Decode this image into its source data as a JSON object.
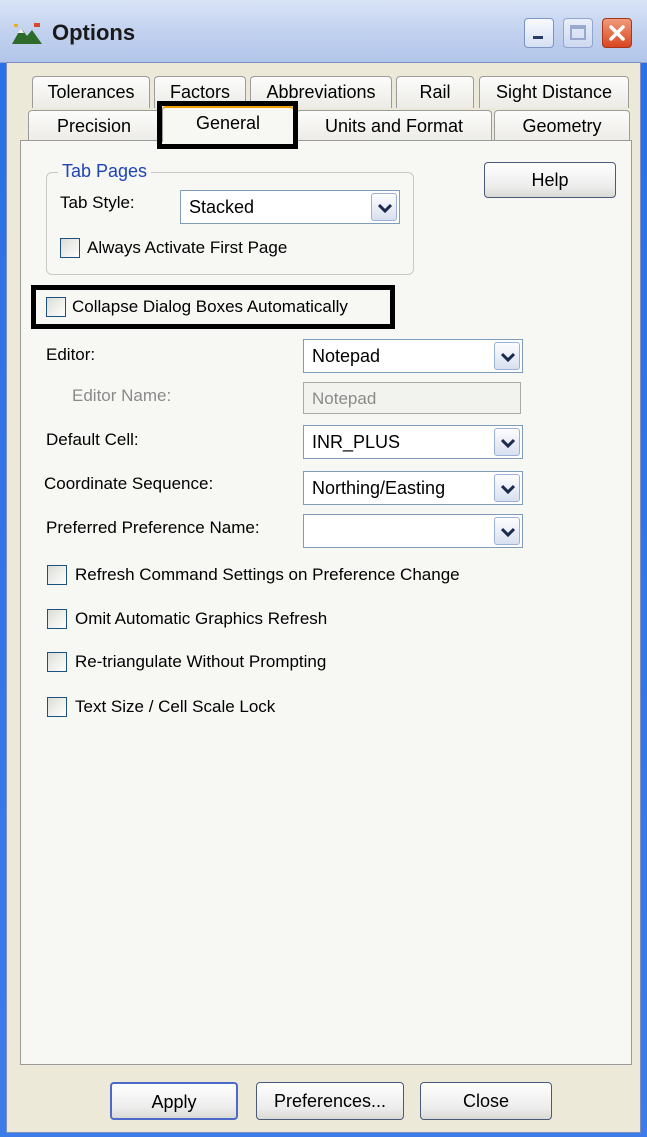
{
  "window": {
    "title": "Options"
  },
  "tabs": {
    "row_top": [
      "Tolerances",
      "Factors",
      "Abbreviations",
      "Rail",
      "Sight Distance"
    ],
    "row_bottom": [
      "Precision",
      "General",
      "Units and Format",
      "Geometry"
    ],
    "active": "General"
  },
  "tab_pages": {
    "legend": "Tab Pages",
    "tab_style_label": "Tab Style:",
    "tab_style_value": "Stacked",
    "always_activate_label": "Always Activate First Page",
    "always_activate_checked": false
  },
  "help_label": "Help",
  "collapse_label": "Collapse Dialog Boxes Automatically",
  "collapse_checked": false,
  "fields": {
    "editor_label": "Editor:",
    "editor_value": "Notepad",
    "editor_name_label": "Editor Name:",
    "editor_name_value": "Notepad",
    "default_cell_label": "Default Cell:",
    "default_cell_value": "INR_PLUS",
    "coord_seq_label": "Coordinate Sequence:",
    "coord_seq_value": "Northing/Easting",
    "pref_name_label": "Preferred Preference Name:",
    "pref_name_value": ""
  },
  "checks": [
    {
      "label": "Refresh Command Settings on Preference Change",
      "checked": false
    },
    {
      "label": "Omit Automatic Graphics Refresh",
      "checked": false
    },
    {
      "label": "Re-triangulate Without Prompting",
      "checked": false
    },
    {
      "label": "Text Size / Cell Scale Lock",
      "checked": false
    }
  ],
  "buttons": {
    "apply": "Apply",
    "preferences": "Preferences...",
    "close": "Close"
  },
  "colors": {
    "group_legend": "#1f45b5",
    "highlight": "#000000",
    "titlebar_close": "#d8461f"
  }
}
